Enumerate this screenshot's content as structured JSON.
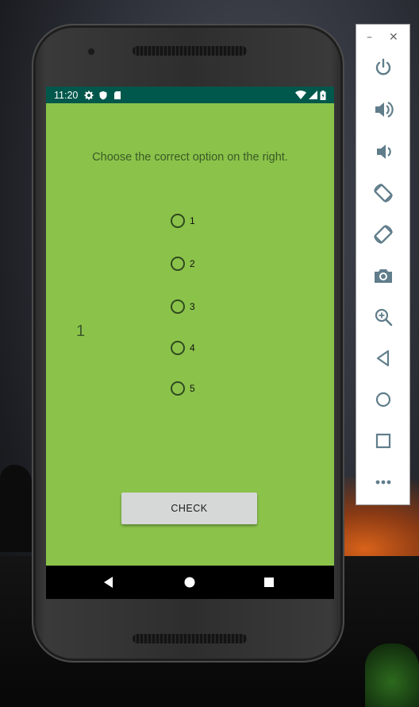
{
  "status_bar": {
    "time": "11:20"
  },
  "app": {
    "prompt": "Choose the correct option on the right.",
    "left_value": "1",
    "options": [
      {
        "label": "1",
        "selected": false
      },
      {
        "label": "2",
        "selected": false
      },
      {
        "label": "3",
        "selected": false
      },
      {
        "label": "4",
        "selected": false
      },
      {
        "label": "5",
        "selected": false
      }
    ],
    "check_label": "CHECK"
  },
  "colors": {
    "app_background": "#8bc34a",
    "status_bar": "#00574b",
    "button": "#d6d7d7"
  },
  "emulator_toolbar": {
    "window_controls": [
      "minimize-icon",
      "close-icon"
    ],
    "buttons": [
      "power-icon",
      "volume-up-icon",
      "volume-down-icon",
      "rotate-left-icon",
      "rotate-right-icon",
      "camera-icon",
      "zoom-icon",
      "back-icon",
      "home-icon",
      "overview-icon",
      "more-icon"
    ]
  },
  "nav_bar": {
    "buttons": [
      "back-icon",
      "home-icon",
      "recents-icon"
    ]
  }
}
